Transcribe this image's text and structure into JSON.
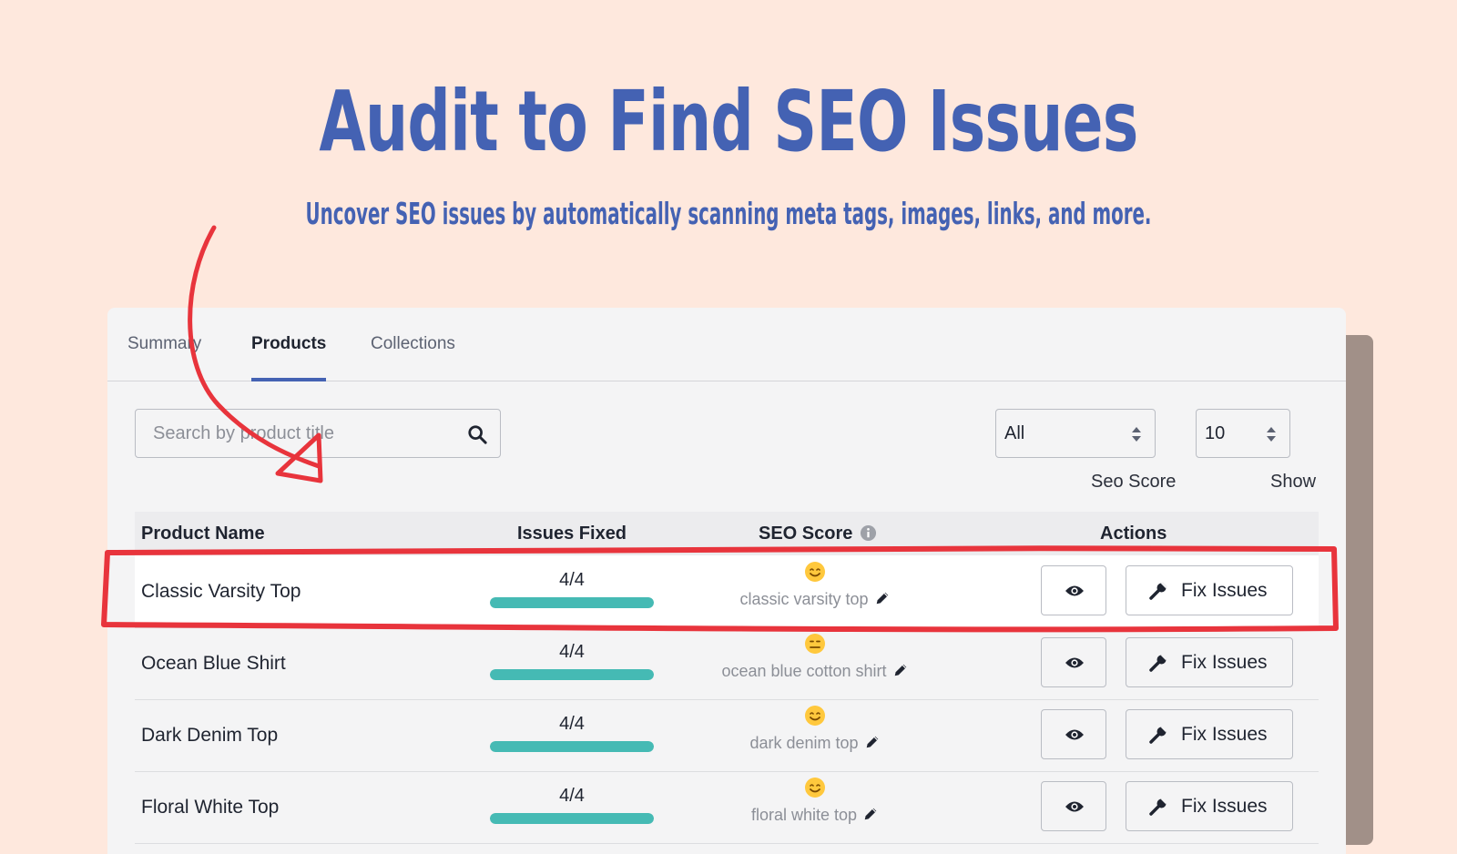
{
  "hero": {
    "title": "Audit to Find SEO Issues",
    "subtitle": "Uncover SEO issues by automatically scanning meta tags, images, links, and more."
  },
  "tabs": [
    {
      "label": "Summary",
      "active": false
    },
    {
      "label": "Products",
      "active": true
    },
    {
      "label": "Collections",
      "active": false
    }
  ],
  "search": {
    "placeholder": "Search by product title",
    "icon": "search-icon"
  },
  "filters": {
    "seo_score": {
      "value": "All",
      "label": "Seo Score"
    },
    "show": {
      "value": "10",
      "label": "Show"
    }
  },
  "table": {
    "columns": [
      "Product Name",
      "Issues Fixed",
      "SEO Score",
      "Actions"
    ],
    "rows": [
      {
        "name": "Classic Varsity Top",
        "issues_fixed": "4/4",
        "progress": 1.0,
        "emoji": "smile",
        "keyword": "classic varsity top",
        "highlighted": true
      },
      {
        "name": "Ocean Blue Shirt",
        "issues_fixed": "4/4",
        "progress": 1.0,
        "emoji": "neutral",
        "keyword": "ocean blue cotton shirt",
        "highlighted": false
      },
      {
        "name": "Dark Denim Top",
        "issues_fixed": "4/4",
        "progress": 1.0,
        "emoji": "smile",
        "keyword": "dark denim top",
        "highlighted": false
      },
      {
        "name": "Floral White Top",
        "issues_fixed": "4/4",
        "progress": 1.0,
        "emoji": "smile",
        "keyword": "floral white top",
        "highlighted": false
      }
    ],
    "action_view_icon": "eye-icon",
    "action_fix_label": "Fix Issues",
    "action_fix_icon": "wrench-icon"
  },
  "colors": {
    "background": "#fee8dd",
    "accent": "#4462b3",
    "progress": "#45bab4",
    "annotation": "#e8343c"
  }
}
